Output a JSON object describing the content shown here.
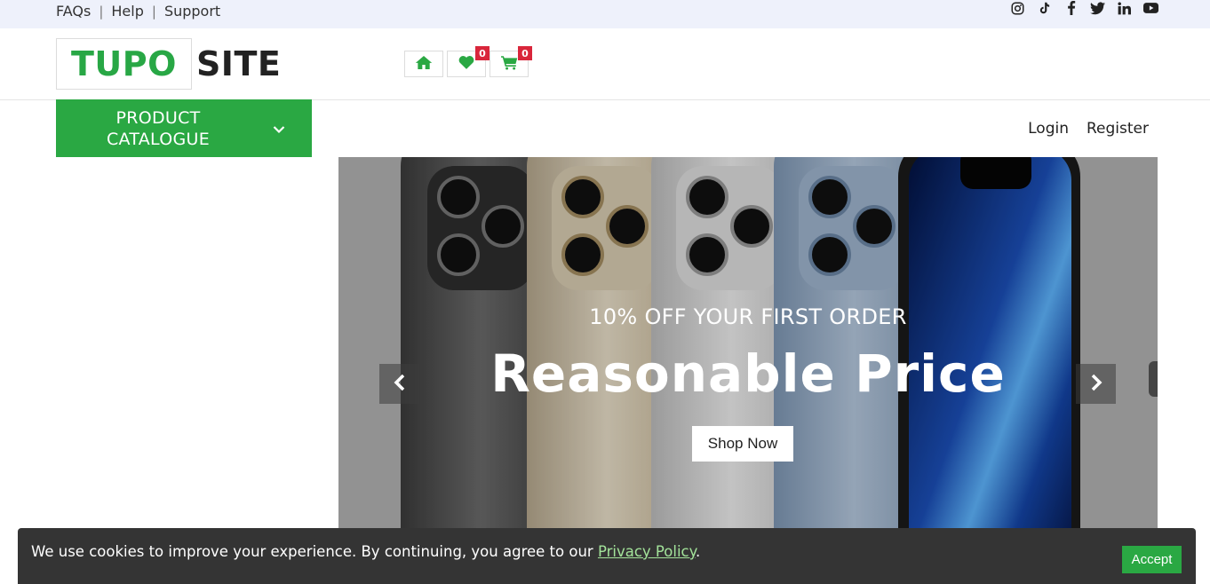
{
  "topbar": {
    "links": [
      "FAQs",
      "Help",
      "Support"
    ],
    "separator": "|",
    "social_icons": [
      "instagram-icon",
      "tiktok-icon",
      "facebook-icon",
      "twitter-icon",
      "linkedin-icon",
      "youtube-icon"
    ]
  },
  "header": {
    "logo_primary": "TUPO",
    "logo_secondary": "SITE",
    "wishlist_count": "0",
    "cart_count": "0"
  },
  "catalogue": {
    "label_line1": "PRODUCT",
    "label_line2": "CATALOGUE"
  },
  "auth": {
    "login": "Login",
    "register": "Register"
  },
  "hero": {
    "subtitle": "10% OFF YOUR FIRST ORDER",
    "title": "Reasonable Price",
    "cta": "Shop Now"
  },
  "cookie": {
    "message": "We use cookies to improve your experience. By continuing, you agree to our",
    "link": "Privacy Policy",
    "period": ".",
    "accept": "Accept"
  },
  "colors": {
    "brand_green": "#2aa843",
    "badge_red": "#d9263b",
    "topbar_bg": "#eef1fb",
    "cookie_bg": "#343434"
  }
}
